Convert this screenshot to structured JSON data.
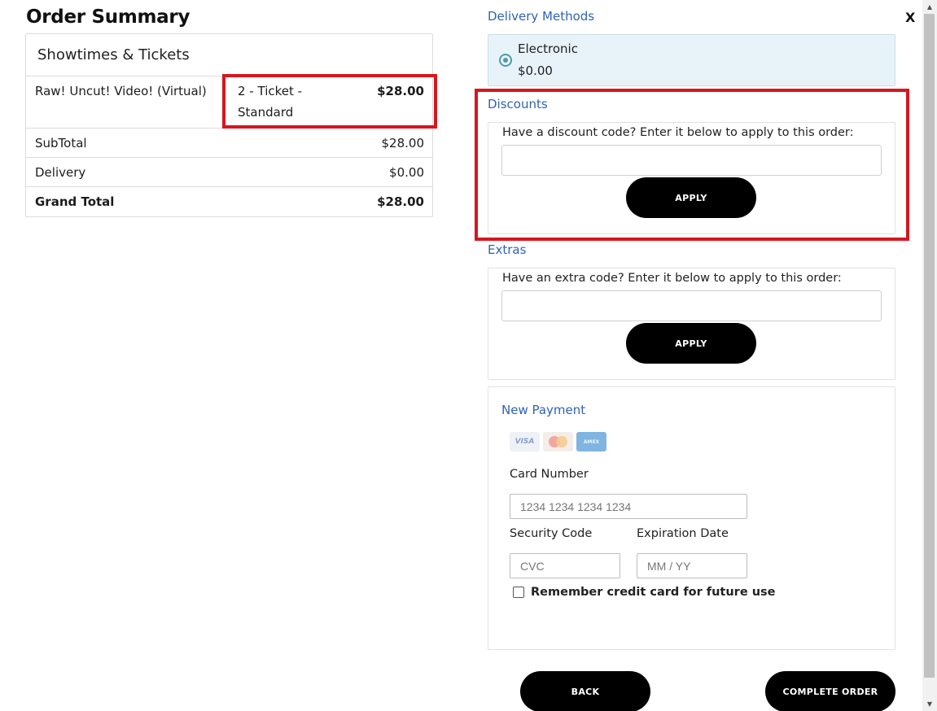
{
  "order_summary": {
    "title": "Order Summary",
    "section_header": "Showtimes & Tickets",
    "item": {
      "name": "Raw! Uncut! Video! (Virtual)",
      "ticket": "2 - Ticket - Standard",
      "price": "$28.00"
    },
    "subtotal": {
      "label": "SubTotal",
      "value": "$28.00"
    },
    "delivery": {
      "label": "Delivery",
      "value": "$0.00"
    },
    "grand_total": {
      "label": "Grand Total",
      "value": "$28.00"
    }
  },
  "close_label": "X",
  "delivery_methods": {
    "title": "Delivery Methods",
    "option": {
      "name": "Electronic",
      "price": "$0.00",
      "selected": true
    }
  },
  "discounts": {
    "title": "Discounts",
    "prompt": "Have a discount code? Enter it below to apply to this order:",
    "input_value": "",
    "button": "APPLY"
  },
  "extras": {
    "title": "Extras",
    "prompt": "Have an extra code? Enter it below to apply to this order:",
    "input_value": "",
    "button": "APPLY"
  },
  "payment": {
    "title": "New Payment",
    "card_logos": [
      "VISA",
      "MasterCard",
      "American Express"
    ],
    "card_number": {
      "label": "Card Number",
      "placeholder": "1234 1234 1234 1234"
    },
    "security_code": {
      "label": "Security Code",
      "placeholder": "CVC"
    },
    "expiration": {
      "label": "Expiration Date",
      "placeholder": "MM / YY"
    },
    "remember_label": "Remember credit card for future use",
    "remember_checked": false
  },
  "buttons": {
    "back": "BACK",
    "complete": "COMPLETE ORDER"
  },
  "colors": {
    "highlight": "#d7161e",
    "link_blue": "#2f63b3",
    "delivery_bg": "#e8f3f9",
    "button_bg": "#000000"
  }
}
